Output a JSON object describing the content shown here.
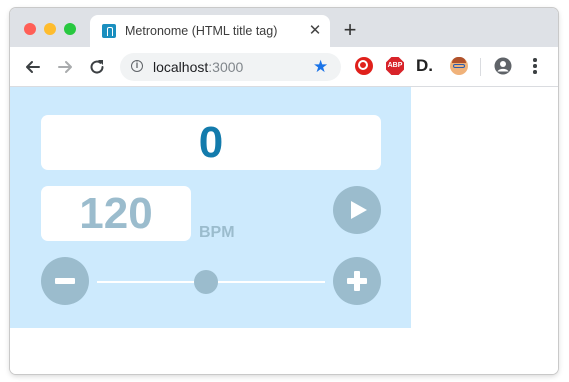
{
  "browser": {
    "tab": {
      "title": "Metronome (HTML title tag)",
      "close": "✕"
    },
    "new_tab": "+",
    "address": {
      "host": "localhost",
      "port": ":3000"
    },
    "extensions": [
      "screen-recorder-icon",
      "adblock-plus-icon",
      "d-extension-icon",
      "avatar-extension-icon"
    ],
    "extension_labels": {
      "abp": "ABP",
      "d": "D."
    }
  },
  "metronome": {
    "count": "0",
    "bpm": "120",
    "bpm_unit": "BPM",
    "tempo_slider": {
      "value": 120
    },
    "colors": {
      "background": "#cdeafd",
      "count": "#137bac",
      "muted": "#9bbccd"
    }
  }
}
